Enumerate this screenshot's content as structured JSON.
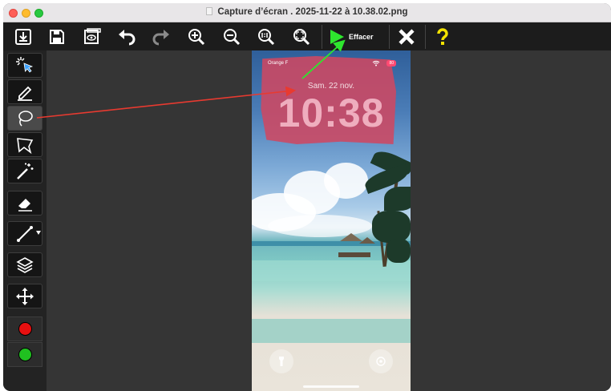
{
  "window": {
    "title": "Capture d’écran . 2025-11-22 à 10.38.02.png"
  },
  "toolbar": {
    "buttons": [
      {
        "name": "import-button",
        "icon": "download-tray-icon"
      },
      {
        "name": "save-button",
        "icon": "floppy-disk-icon"
      },
      {
        "name": "preview-button",
        "icon": "eye-window-icon"
      },
      {
        "name": "undo-button",
        "icon": "undo-arrow-icon"
      },
      {
        "name": "redo-button",
        "icon": "redo-arrow-icon"
      },
      {
        "name": "zoom-in-button",
        "icon": "zoom-in-icon"
      },
      {
        "name": "zoom-out-button",
        "icon": "zoom-out-icon"
      },
      {
        "name": "zoom-actual-button",
        "icon": "zoom-1to1-icon"
      },
      {
        "name": "zoom-fit-button",
        "icon": "zoom-fit-icon"
      }
    ],
    "effacer_label": "Effacer",
    "colors": {
      "play": "#2ee62e",
      "close": "#ffffff",
      "help": "#f2e200"
    }
  },
  "tools": [
    {
      "name": "selection-tool",
      "icon": "pointer-sparkle-icon",
      "active": false
    },
    {
      "name": "brush-tool",
      "icon": "pencil-icon",
      "active": false
    },
    {
      "name": "lasso-tool",
      "icon": "lasso-icon",
      "active": true
    },
    {
      "name": "polygon-lasso-tool",
      "icon": "polygon-lasso-icon",
      "active": false
    },
    {
      "name": "magic-wand-tool",
      "icon": "magic-wand-icon",
      "active": false
    },
    {
      "name": "eraser-tool",
      "icon": "eraser-icon",
      "active": false
    },
    {
      "name": "line-tool",
      "icon": "line-icon",
      "active": false
    },
    {
      "name": "layers-tool",
      "icon": "layers-icon",
      "active": false
    },
    {
      "name": "move-tool",
      "icon": "move-arrows-icon",
      "active": false
    }
  ],
  "colors": {
    "foreground": "#e81010",
    "background": "#20c020",
    "selection_mask": "#ce4862",
    "annotation_red": "#e83a30",
    "annotation_green": "#2ee62e"
  },
  "phone": {
    "carrier": "Orange F",
    "battery": "80",
    "date": "Sam. 22 nov.",
    "time": "10:38"
  }
}
